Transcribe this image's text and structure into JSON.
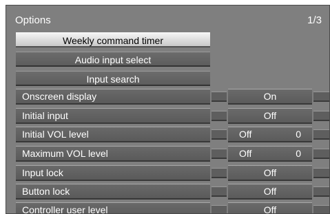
{
  "window": {
    "title": "Options",
    "page": "1/3"
  },
  "actions": [
    {
      "label": "Weekly command timer",
      "style": "selected"
    },
    {
      "label": "Audio input select",
      "style": "normal"
    },
    {
      "label": "Input search",
      "style": "normal"
    }
  ],
  "settings": [
    {
      "label": "Onscreen display",
      "value": "On"
    },
    {
      "label": "Initial input",
      "value": "Off"
    },
    {
      "label": "Initial VOL level",
      "value": "Off",
      "level": "0"
    },
    {
      "label": "Maximum VOL level",
      "value": "Off",
      "level": "0"
    },
    {
      "label": "Input lock",
      "value": "Off"
    },
    {
      "label": "Button lock",
      "value": "Off"
    },
    {
      "label": "Controller user level",
      "value": "Off"
    }
  ]
}
